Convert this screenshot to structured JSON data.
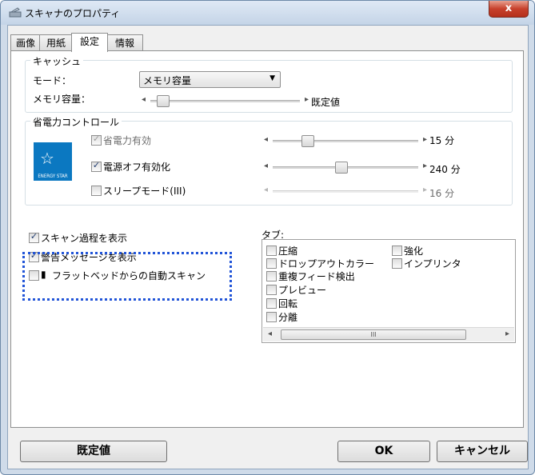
{
  "window": {
    "title": "スキャナのプロパティ",
    "close_label": "x"
  },
  "tabs": [
    {
      "label": "画像"
    },
    {
      "label": "用紙"
    },
    {
      "label": "設定"
    },
    {
      "label": "情報"
    }
  ],
  "cache": {
    "legend": "キャッシュ",
    "mode_label": "モード：",
    "mode_value": "メモリ容量",
    "memory_label": "メモリ容量：",
    "memory_slider_value_label": "既定値"
  },
  "power": {
    "legend": "省電力コントロール",
    "energy_star_text": "ENERGY STAR",
    "rows": [
      {
        "label": "省電力有効",
        "checked": true,
        "enabled": false,
        "value": "15 分"
      },
      {
        "label": "電源オフ有効化",
        "checked": true,
        "enabled": true,
        "value": "240 分"
      },
      {
        "label": "スリープモード(III)",
        "checked": false,
        "enabled": true,
        "value": "16 分"
      }
    ]
  },
  "options": {
    "show_progress": "スキャン過程を表示",
    "show_warning": "警告メッセージを表示",
    "auto_scan": "フラットベッドからの自動スキャン"
  },
  "types": {
    "label": "タブ:",
    "col1": [
      "圧縮",
      "ドロップアウトカラー",
      "重複フィード検出",
      "プレビュー",
      "回転",
      "分離"
    ],
    "col2": [
      "強化",
      "インプリンタ"
    ],
    "scroll_grip": "III"
  },
  "buttons": {
    "default_label": "既定値",
    "ok_label": "OK",
    "cancel_label": "キャンセル"
  }
}
